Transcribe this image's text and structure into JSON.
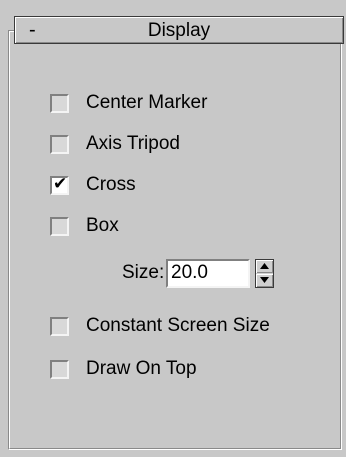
{
  "rollout": {
    "toggle_symbol": "-",
    "title": "Display"
  },
  "options": [
    {
      "label": "Center Marker",
      "checked": false
    },
    {
      "label": "Axis Tripod",
      "checked": false
    },
    {
      "label": "Cross",
      "checked": true
    },
    {
      "label": "Box",
      "checked": false
    }
  ],
  "size": {
    "label": "Size:",
    "value": "20.0"
  },
  "extra_options": [
    {
      "label": "Constant Screen Size",
      "checked": false
    },
    {
      "label": "Draw On Top",
      "checked": false
    }
  ],
  "checkmark_glyph": "✔"
}
